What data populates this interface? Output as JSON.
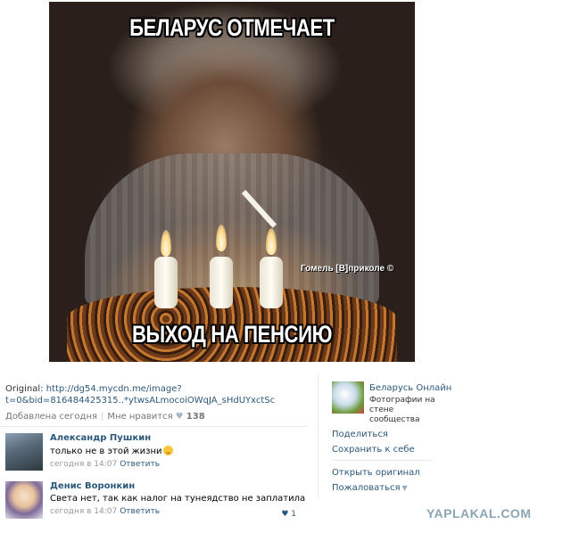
{
  "photo": {
    "caption_top": "БЕЛАРУС ОТМЕЧАЕТ",
    "caption_bottom": "ВЫХОД НА ПЕНСИЮ",
    "watermark": "Гомель [В]приколе ©"
  },
  "post": {
    "original_label": "Original:",
    "original_url_line1": "http://dg54.mycdn.me/image?",
    "original_url_line2": "t=0&bid=816484425315..*ytwsALmocoiOWqJA_sHdUYxctSc",
    "added": "Добавлена сегодня",
    "likes_label": "Мне нравится",
    "likes_count": "138"
  },
  "comments": [
    {
      "author": "Александр Пушкин",
      "text": "только не в этой жизни",
      "date": "сегодня в 14:07",
      "reply": "Ответить",
      "likes": ""
    },
    {
      "author": "Денис Воронкин",
      "text": "Света нет, так как налог на тунеядство не заплатила",
      "date": "сегодня в 14:07",
      "reply": "Ответить",
      "likes": "1"
    }
  ],
  "sidebar": {
    "group_name": "Беларусь Онлайн",
    "group_desc": "Фотографии на стене сообщества",
    "share": "Поделиться",
    "save": "Сохранить к себе",
    "open_original": "Открыть оригинал",
    "report": "Пожаловаться"
  },
  "site_watermark": "YAPLAKAL.COM"
}
